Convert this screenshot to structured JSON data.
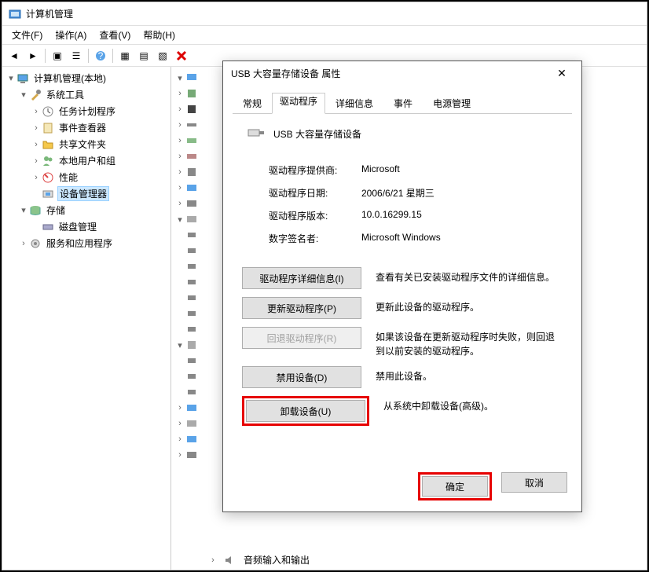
{
  "window": {
    "title": "计算机管理"
  },
  "menu": {
    "file": "文件(F)",
    "action": "操作(A)",
    "view": "查看(V)",
    "help": "帮助(H)"
  },
  "tree": {
    "root": "计算机管理(本地)",
    "systools": "系统工具",
    "task": "任务计划程序",
    "event": "事件查看器",
    "shared": "共享文件夹",
    "users": "本地用户和组",
    "perf": "性能",
    "devmgr": "设备管理器",
    "storage": "存储",
    "disk": "磁盘管理",
    "services": "服务和应用程序"
  },
  "dialog": {
    "title": "USB 大容量存储设备 属性",
    "tabs": {
      "general": "常规",
      "driver": "驱动程序",
      "details": "详细信息",
      "events": "事件",
      "power": "电源管理"
    },
    "device_name": "USB 大容量存储设备",
    "info": {
      "provider_label": "驱动程序提供商:",
      "provider": "Microsoft",
      "date_label": "驱动程序日期:",
      "date": "2006/6/21 星期三",
      "version_label": "驱动程序版本:",
      "version": "10.0.16299.15",
      "signer_label": "数字签名者:",
      "signer": "Microsoft Windows"
    },
    "buttons": {
      "details": "驱动程序详细信息(I)",
      "details_desc": "查看有关已安装驱动程序文件的详细信息。",
      "update": "更新驱动程序(P)",
      "update_desc": "更新此设备的驱动程序。",
      "rollback": "回退驱动程序(R)",
      "rollback_desc": "如果该设备在更新驱动程序时失败，则回退到以前安装的驱动程序。",
      "disable": "禁用设备(D)",
      "disable_desc": "禁用此设备。",
      "uninstall": "卸载设备(U)",
      "uninstall_desc": "从系统中卸载设备(高级)。"
    },
    "ok": "确定",
    "cancel": "取消"
  },
  "bottom": "音频输入和输出"
}
